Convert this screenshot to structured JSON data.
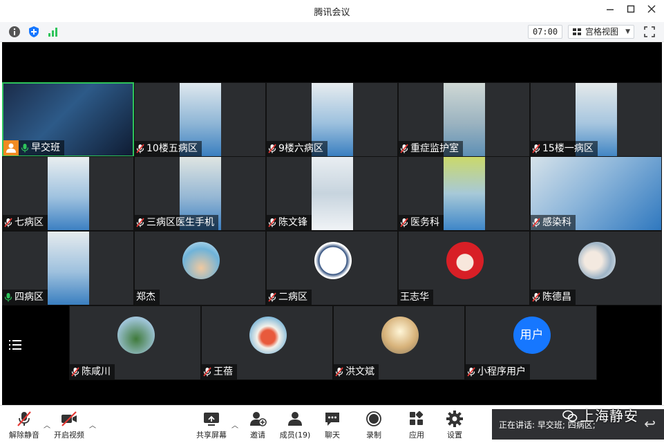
{
  "window": {
    "title": "腾讯会议"
  },
  "infobar": {
    "timer": "07:00",
    "view_label": "宫格视图"
  },
  "participants": [
    {
      "name": "早交班",
      "mic": "on",
      "badge": true,
      "active": true
    },
    {
      "name": "10楼五病区",
      "mic": "off"
    },
    {
      "name": "9楼六病区",
      "mic": "off"
    },
    {
      "name": "重症监护室",
      "mic": "off"
    },
    {
      "name": "15楼一病区",
      "mic": "off"
    },
    {
      "name": "七病区",
      "mic": "off"
    },
    {
      "name": "三病区医生手机",
      "mic": "off"
    },
    {
      "name": "陈文锋",
      "mic": "off"
    },
    {
      "name": "医务科",
      "mic": "off"
    },
    {
      "name": "感染科",
      "mic": "off"
    },
    {
      "name": "四病区",
      "mic": "on"
    },
    {
      "name": "郑杰",
      "mic": "none"
    },
    {
      "name": "二病区",
      "mic": "off"
    },
    {
      "name": "王志华",
      "mic": "none"
    },
    {
      "name": "陈德昌",
      "mic": "off"
    },
    {
      "name": "陈咸川",
      "mic": "off"
    },
    {
      "name": "王蓓",
      "mic": "off"
    },
    {
      "name": "洪文斌",
      "mic": "off"
    },
    {
      "name": "小程序用户",
      "mic": "off",
      "avatar_text": "用户"
    }
  ],
  "toolbar": {
    "unmute": "解除静音",
    "start_video": "开启视频",
    "share": "共享屏幕",
    "invite": "邀请",
    "members": "成员(19)",
    "chat": "聊天",
    "record": "录制",
    "apps": "应用",
    "settings": "设置"
  },
  "speaking": "正在讲话: 早交班; 四病区;",
  "watermark": "上海静安",
  "colors": {
    "active_border": "#2ec45b",
    "mic_off": "#e53935",
    "mic_on": "#2ec45b",
    "badge": "#f28b22",
    "avatar_blue": "#1677ff"
  }
}
